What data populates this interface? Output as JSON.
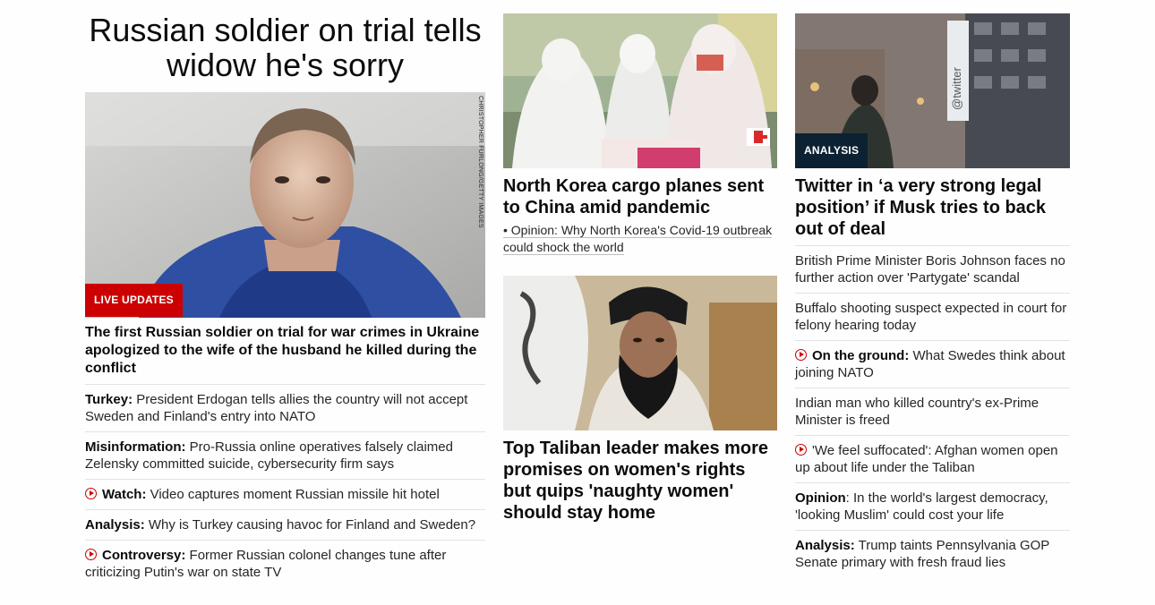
{
  "col1": {
    "headline": "Russian soldier on trial tells widow he's sorry",
    "image_credit": "CHRISTOPHER FURLONG/GETTY IMAGES",
    "badge": "LIVE UPDATES",
    "lead": "The first Russian soldier on trial for war crimes in Ukraine apologized to the wife of the husband he killed during the conflict",
    "items": [
      {
        "label": "Turkey:",
        "text": " President Erdogan tells allies the country will not accept Sweden and Finland's entry into NATO",
        "video": false
      },
      {
        "label": "Misinformation:",
        "text": " Pro-Russia online operatives falsely claimed Zelensky committed suicide, cybersecurity firm says",
        "video": false
      },
      {
        "label": "Watch:",
        "text": " Video captures moment Russian missile hit hotel",
        "video": true
      },
      {
        "label": "Analysis:",
        "text": " Why is Turkey causing havoc for Finland and Sweden?",
        "video": false
      },
      {
        "label": "Controversy:",
        "text": " Former Russian colonel changes tune after criticizing Putin's war on state TV",
        "video": true
      }
    ]
  },
  "col2": {
    "story1": {
      "headline": "North Korea cargo planes sent to China amid pandemic",
      "sub": "• Opinion: Why North Korea's Covid-19 outbreak could shock the world"
    },
    "story2": {
      "headline": "Top Taliban leader makes more promises on women's rights but quips 'naughty women' should stay home"
    }
  },
  "col3": {
    "badge": "ANALYSIS",
    "headline": "Twitter in ‘a very strong legal position’ if Musk tries to back out of deal",
    "image_sign": "@twitter",
    "items": [
      {
        "label": "",
        "text": "British Prime Minister Boris Johnson faces no further action over 'Partygate' scandal",
        "video": false
      },
      {
        "label": "",
        "text": "Buffalo shooting suspect expected in court for felony hearing today",
        "video": false
      },
      {
        "label": "On the ground:",
        "text": " What Swedes think about joining NATO",
        "video": true
      },
      {
        "label": "",
        "text": "Indian man who killed country's ex-Prime Minister is freed",
        "video": false
      },
      {
        "label": "",
        "text": "'We feel suffocated': Afghan women open up about life under the Taliban",
        "video": true
      },
      {
        "label": "Opinion",
        "text": ": In the world's largest democracy, 'looking Muslim' could cost your life",
        "video": false
      },
      {
        "label": "Analysis:",
        "text": " Trump taints Pennsylvania GOP Senate primary with fresh fraud lies",
        "video": false
      }
    ]
  }
}
